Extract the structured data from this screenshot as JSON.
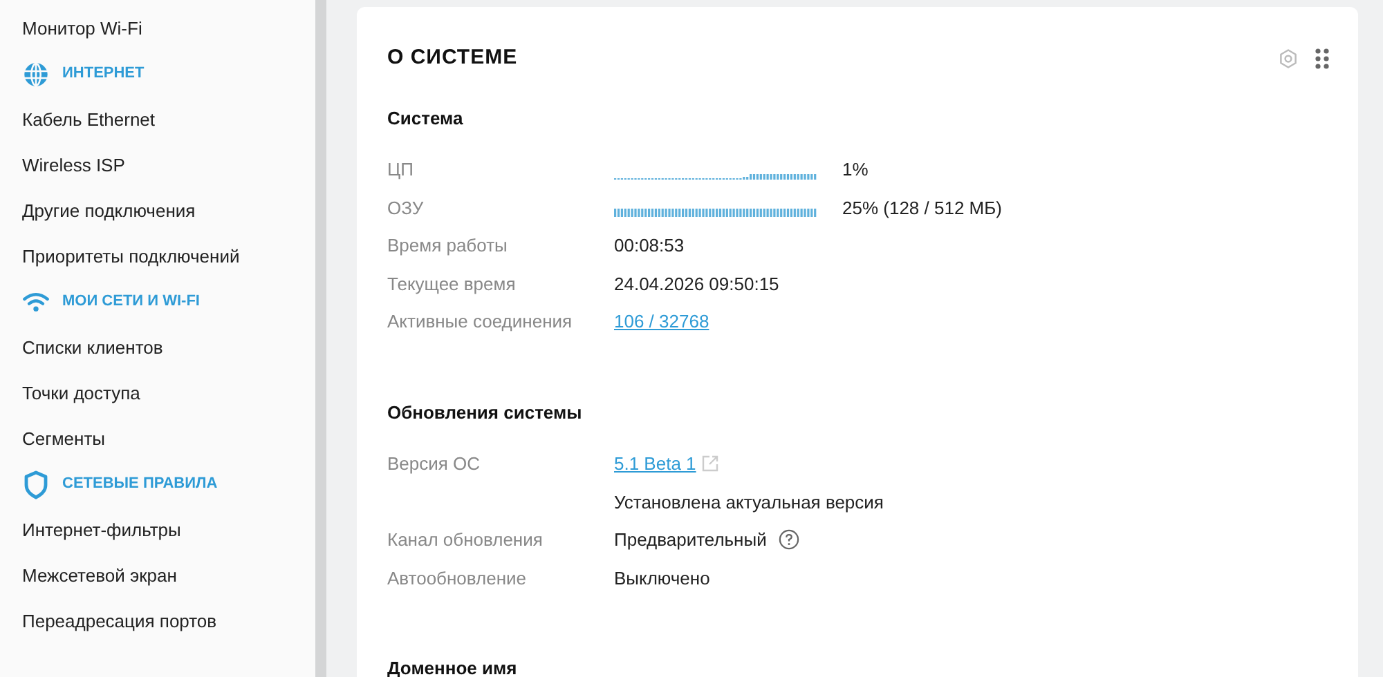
{
  "sidebar": {
    "items": [
      {
        "kind": "link",
        "label": "Монитор Wi-Fi"
      },
      {
        "kind": "header",
        "label": "ИНТЕРНЕТ"
      },
      {
        "kind": "link",
        "label": "Кабель Ethernet"
      },
      {
        "kind": "link",
        "label": "Wireless ISP"
      },
      {
        "kind": "link",
        "label": "Другие подключения"
      },
      {
        "kind": "link",
        "label": "Приоритеты подключений"
      },
      {
        "kind": "header",
        "label": "МОИ СЕТИ И WI-FI"
      },
      {
        "kind": "link",
        "label": "Списки клиентов"
      },
      {
        "kind": "link",
        "label": "Точки доступа"
      },
      {
        "kind": "link",
        "label": "Сегменты"
      },
      {
        "kind": "header",
        "label": "СЕТЕВЫЕ ПРАВИЛА"
      },
      {
        "kind": "link",
        "label": "Интернет-фильтры"
      },
      {
        "kind": "link",
        "label": "Межсетевой экран"
      },
      {
        "kind": "link",
        "label": "Переадресация портов"
      }
    ]
  },
  "card": {
    "title": "О СИСТЕМЕ",
    "sections": [
      {
        "title": "Система",
        "rows": [
          {
            "kind": "graph",
            "label": "ЦП",
            "value": "1%"
          },
          {
            "kind": "graph",
            "label": "ОЗУ",
            "value": "25% (128 / 512 МБ)"
          },
          {
            "kind": "text",
            "label": "Время работы",
            "value": "00:08:53"
          },
          {
            "kind": "text",
            "label": "Текущее время",
            "value": "24.04.2026 09:50:15"
          },
          {
            "kind": "link",
            "label": "Активные соединения",
            "value": "106 / 32768"
          }
        ]
      },
      {
        "title": "Обновления системы",
        "rows": [
          {
            "kind": "external",
            "label": "Версия ОС",
            "value": "5.1 Beta 1"
          },
          {
            "kind": "text",
            "value": "Установлена актуальная версия"
          },
          {
            "kind": "help",
            "label": "Канал обновления",
            "value": "Предварительный"
          },
          {
            "kind": "text",
            "label": "Автообновление",
            "value": "Выключено"
          }
        ]
      },
      {
        "title": "Доменное имя"
      }
    ]
  }
}
